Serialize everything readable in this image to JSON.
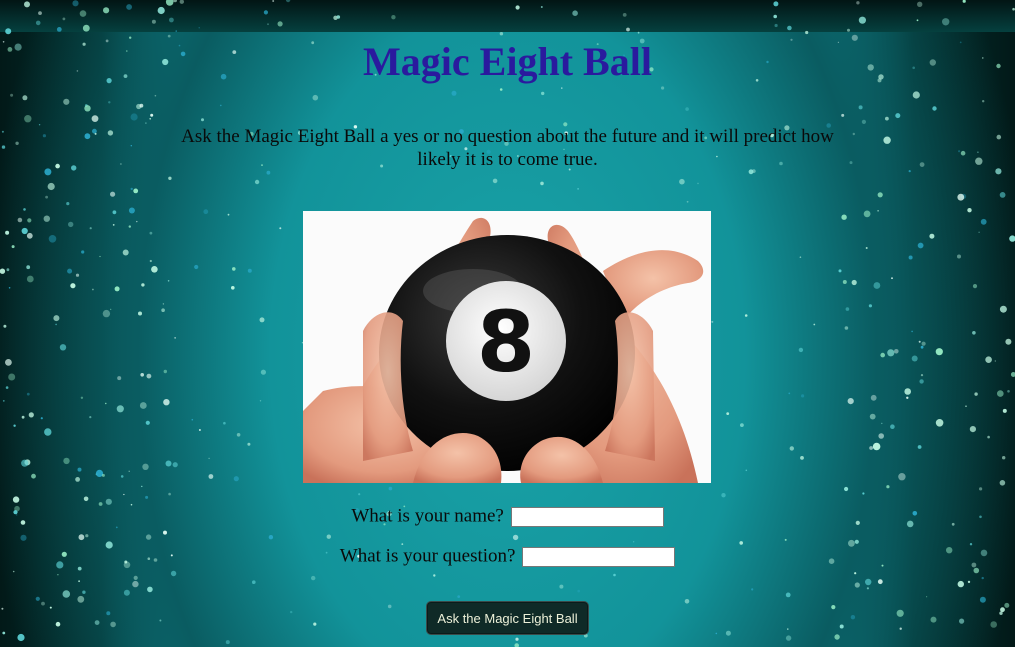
{
  "page": {
    "title": "Magic Eight Ball",
    "intro": "Ask the Magic Eight Ball a yes or no question about the future and it will predict how likely it is to come true."
  },
  "image": {
    "icon": "magic-eight-ball-photo",
    "digit": "8"
  },
  "form": {
    "name_label": "What is your name?",
    "name_value": "",
    "question_label": "What is your question?",
    "question_value": "",
    "submit_label": "Ask the Magic Eight Ball"
  },
  "colors": {
    "title": "#2a1a9e",
    "background_teal": "#129aa0",
    "background_dark": "#03201f",
    "button_bg": "#0f2a27",
    "button_text": "#ecf0d8"
  }
}
